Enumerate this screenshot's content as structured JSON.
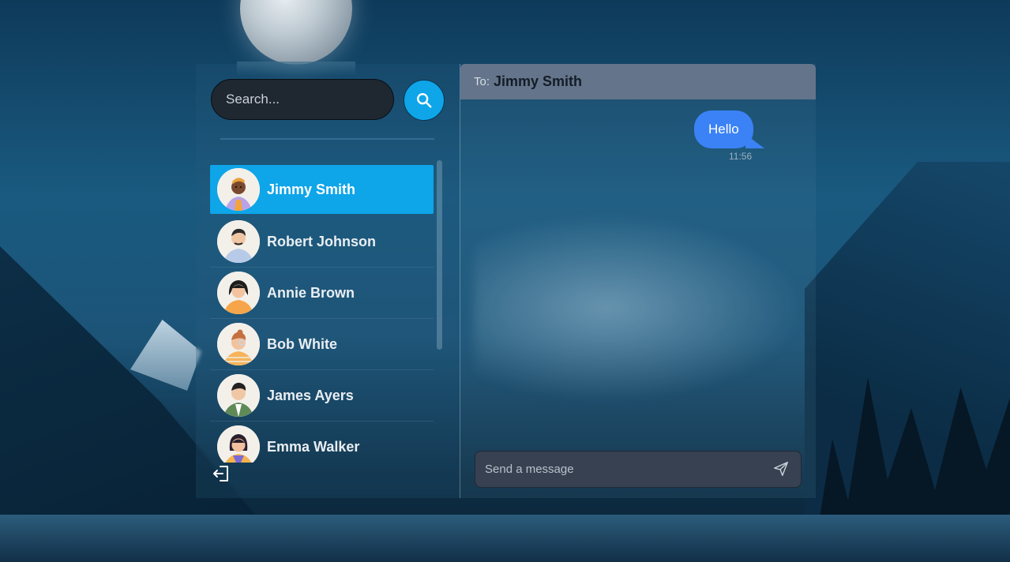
{
  "search": {
    "placeholder": "Search..."
  },
  "contacts": [
    {
      "name": "Jimmy Smith",
      "active": true
    },
    {
      "name": "Robert Johnson",
      "active": false
    },
    {
      "name": "Annie Brown",
      "active": false
    },
    {
      "name": "Bob White",
      "active": false
    },
    {
      "name": "James Ayers",
      "active": false
    },
    {
      "name": "Emma Walker",
      "active": false
    }
  ],
  "chat": {
    "to_label": "To:",
    "recipient": "Jimmy Smith",
    "messages": [
      {
        "text": "Hello",
        "time": "11:56",
        "outgoing": true
      }
    ],
    "composer_placeholder": "Send a message"
  },
  "colors": {
    "accent": "#0ea5e9",
    "bubble": "#3b82f6",
    "header": "#64748b",
    "composer": "#374151"
  },
  "icons": {
    "search": "search-icon",
    "send": "send-icon",
    "logout": "logout-icon"
  }
}
